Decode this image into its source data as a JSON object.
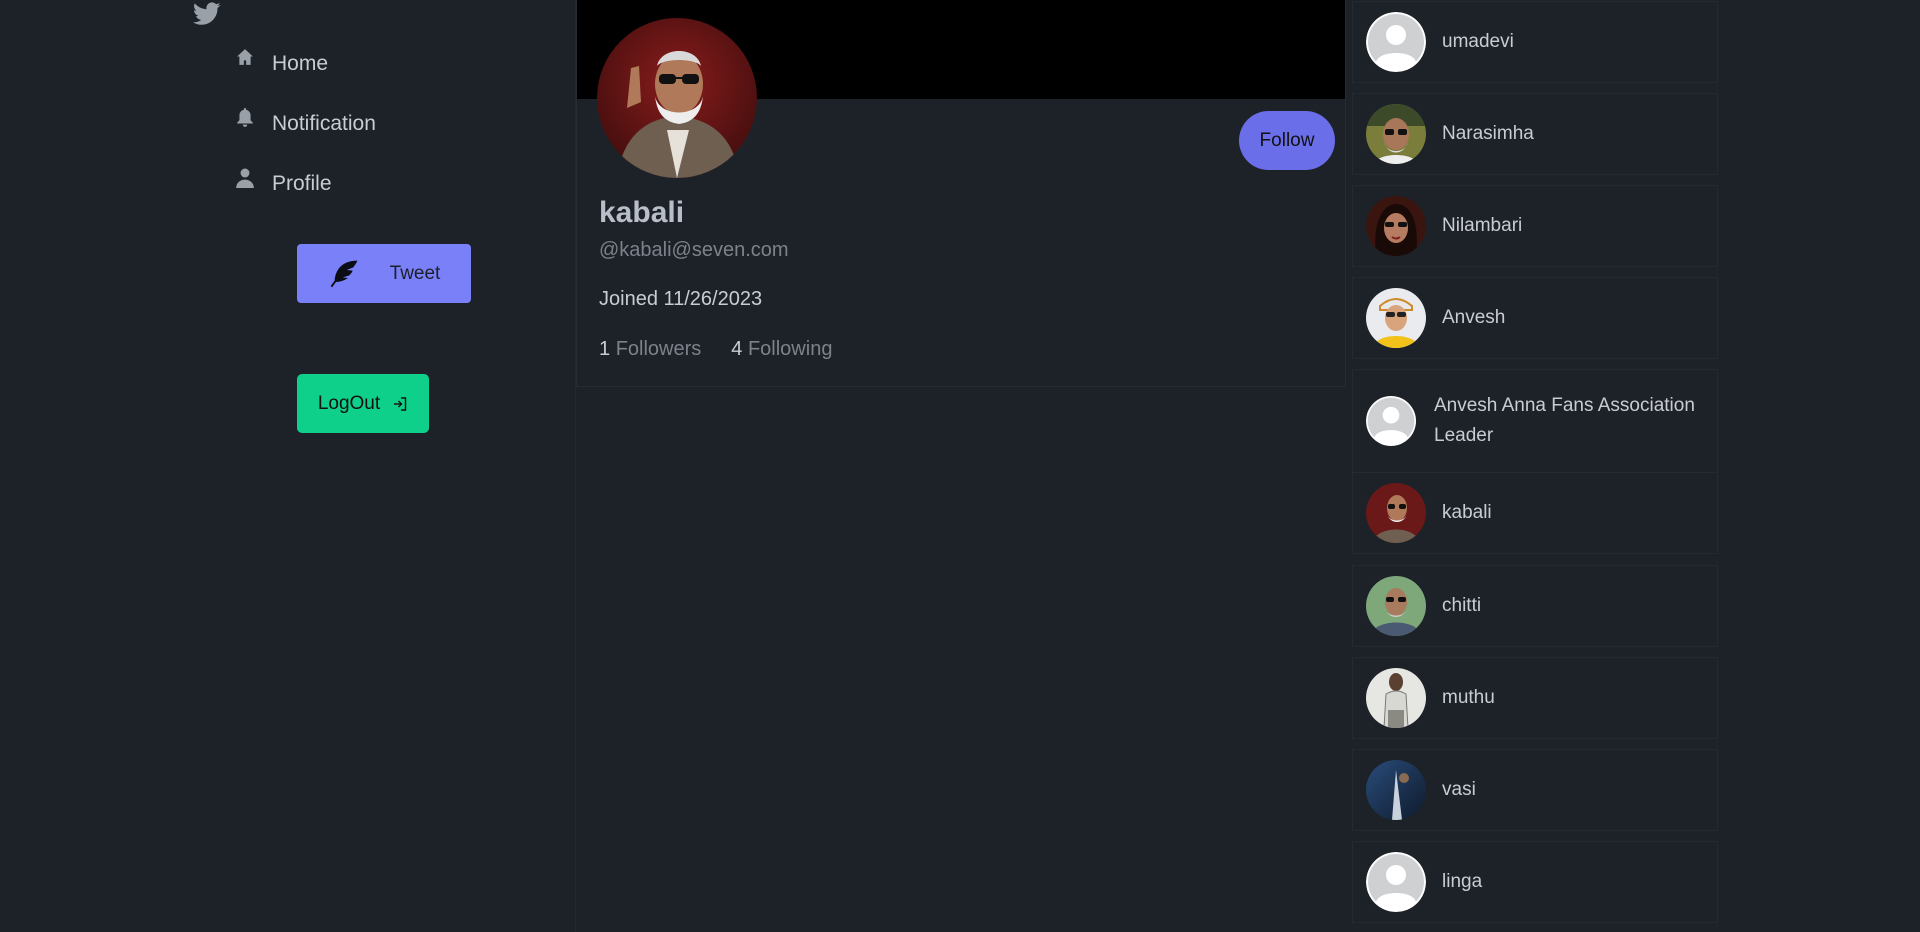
{
  "colors": {
    "background": "#1d2229",
    "tweet_button": "#7a80f7",
    "logout_button": "#0ed08a",
    "follow_button": "#6a6ee9",
    "banner": "#000000"
  },
  "sidebar": {
    "logo_icon": "twitter-bird-icon",
    "nav": [
      {
        "label": "Home",
        "icon": "home-icon"
      },
      {
        "label": "Notification",
        "icon": "bell-icon"
      },
      {
        "label": "Profile",
        "icon": "person-icon"
      }
    ],
    "tweet_label": "Tweet",
    "logout_label": "LogOut"
  },
  "profile": {
    "name": "kabali",
    "handle": "@kabali@seven.com",
    "joined": "Joined 11/26/2023",
    "followers_count": "1",
    "followers_label": "Followers",
    "following_count": "4",
    "following_label": "Following",
    "follow_label": "Follow"
  },
  "users": [
    {
      "name": "umadevi",
      "avatar": "default"
    },
    {
      "name": "Narasimha",
      "avatar": "photo"
    },
    {
      "name": "Nilambari",
      "avatar": "photo"
    },
    {
      "name": "Anvesh",
      "avatar": "photo"
    },
    {
      "name": "Anvesh Anna Fans Association Leader",
      "avatar": "default"
    },
    {
      "name": "kabali",
      "avatar": "photo"
    },
    {
      "name": "chitti",
      "avatar": "photo"
    },
    {
      "name": "muthu",
      "avatar": "photo"
    },
    {
      "name": "vasi",
      "avatar": "photo"
    },
    {
      "name": "linga",
      "avatar": "default"
    }
  ]
}
